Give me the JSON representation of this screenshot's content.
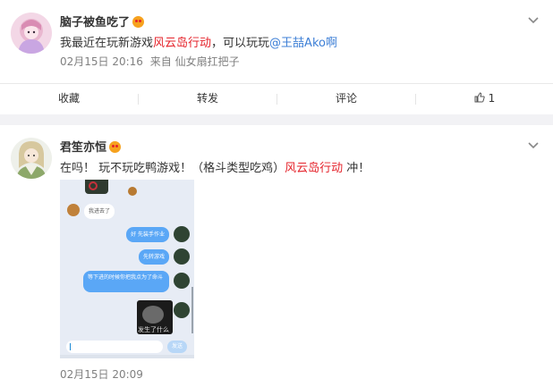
{
  "post1": {
    "username": "脑子被鱼吃了",
    "text_before": "我最近在玩新游戏",
    "game_link": "风云岛行动",
    "text_middle": "，可以玩玩",
    "mention": "@王喆Ako啊",
    "time": "02月15日 20:16",
    "source_prefix": "来自",
    "source": "仙女扇扛把子",
    "actions": {
      "favorite": "收藏",
      "repost": "转发",
      "comment": "评论",
      "like_count": "1"
    }
  },
  "post2": {
    "username": "君笙亦恒",
    "text_before": "在吗！ 玩不玩吃鸭游戏！（格斗类型吃鸡）",
    "game_link": "风云岛行动",
    "text_after": " 冲！",
    "time": "02月15日 20:09",
    "screenshot": {
      "incoming_message": "我进去了",
      "outgoing_messages": [
        "好 先装手作业",
        "先转游戏",
        "等下进的时候你把我点为了命斗"
      ],
      "photo_caption": "发生了什么",
      "send_label": "发送"
    }
  },
  "colors": {
    "link_red": "#e5232b",
    "mention_blue": "#3d7fd6",
    "meta_gray": "#808080",
    "chat_bubble_blue": "#5aa7f6"
  },
  "icons": {
    "dropdown": "chevron-down-icon",
    "vip": "vip-badge-icon",
    "like": "thumbs-up-icon"
  }
}
